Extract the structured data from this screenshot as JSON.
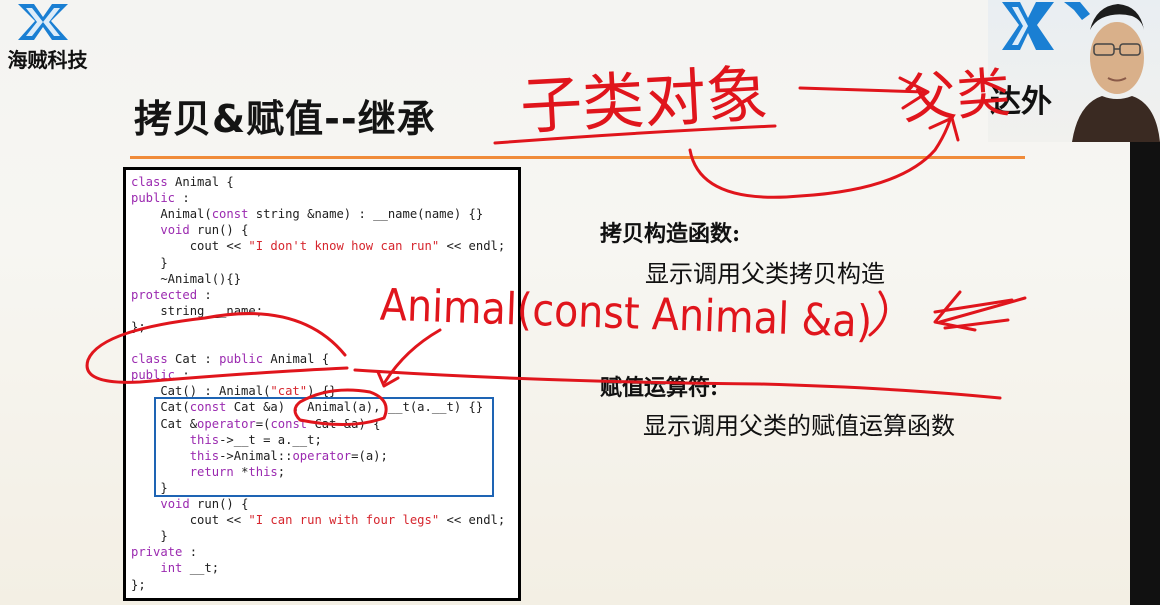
{
  "logo": {
    "name": "海贼科技"
  },
  "slide": {
    "title": "拷贝&赋值--继承"
  },
  "code_lines": [
    {
      "tokens": [
        {
          "t": "class",
          "c": "kw"
        },
        {
          "t": " Animal {",
          "c": ""
        }
      ]
    },
    {
      "tokens": [
        {
          "t": "public",
          "c": "kw"
        },
        {
          "t": " :",
          "c": ""
        }
      ]
    },
    {
      "tokens": [
        {
          "t": "    Animal(",
          "c": ""
        },
        {
          "t": "const",
          "c": "kw"
        },
        {
          "t": " string &name) : __name(name) {}",
          "c": ""
        }
      ]
    },
    {
      "tokens": [
        {
          "t": "    ",
          "c": ""
        },
        {
          "t": "void",
          "c": "kw"
        },
        {
          "t": " run() {",
          "c": ""
        }
      ]
    },
    {
      "tokens": [
        {
          "t": "        cout << ",
          "c": ""
        },
        {
          "t": "\"I don't know how can run\"",
          "c": "str"
        },
        {
          "t": " << endl;",
          "c": ""
        }
      ]
    },
    {
      "tokens": [
        {
          "t": "    }",
          "c": ""
        }
      ]
    },
    {
      "tokens": [
        {
          "t": "    ~Animal(){}",
          "c": ""
        }
      ]
    },
    {
      "tokens": [
        {
          "t": "protected",
          "c": "kw"
        },
        {
          "t": " :",
          "c": ""
        }
      ]
    },
    {
      "tokens": [
        {
          "t": "    string __name;",
          "c": ""
        }
      ]
    },
    {
      "tokens": [
        {
          "t": "};",
          "c": ""
        }
      ]
    },
    {
      "tokens": [
        {
          "t": "",
          "c": ""
        }
      ]
    },
    {
      "tokens": [
        {
          "t": "class",
          "c": "kw"
        },
        {
          "t": " Cat : ",
          "c": ""
        },
        {
          "t": "public",
          "c": "kw"
        },
        {
          "t": " Animal {",
          "c": ""
        }
      ]
    },
    {
      "tokens": [
        {
          "t": "public",
          "c": "kw"
        },
        {
          "t": " :",
          "c": ""
        }
      ]
    },
    {
      "tokens": [
        {
          "t": "    Cat() : Animal(",
          "c": ""
        },
        {
          "t": "\"cat\"",
          "c": "str"
        },
        {
          "t": ") {}",
          "c": ""
        }
      ]
    },
    {
      "tokens": [
        {
          "t": "    Cat(",
          "c": ""
        },
        {
          "t": "const",
          "c": "kw"
        },
        {
          "t": " Cat &a) : Animal(a), __t(a.__t) {}",
          "c": ""
        }
      ]
    },
    {
      "tokens": [
        {
          "t": "    Cat &",
          "c": ""
        },
        {
          "t": "operator",
          "c": "kw"
        },
        {
          "t": "=(",
          "c": ""
        },
        {
          "t": "const",
          "c": "kw"
        },
        {
          "t": " Cat &a) {",
          "c": ""
        }
      ]
    },
    {
      "tokens": [
        {
          "t": "        ",
          "c": ""
        },
        {
          "t": "this",
          "c": "kw"
        },
        {
          "t": "->__t = a.__t;",
          "c": ""
        }
      ]
    },
    {
      "tokens": [
        {
          "t": "        ",
          "c": ""
        },
        {
          "t": "this",
          "c": "kw"
        },
        {
          "t": "->Animal::",
          "c": ""
        },
        {
          "t": "operator",
          "c": "kw"
        },
        {
          "t": "=(a);",
          "c": ""
        }
      ]
    },
    {
      "tokens": [
        {
          "t": "        ",
          "c": ""
        },
        {
          "t": "return",
          "c": "kw"
        },
        {
          "t": " *",
          "c": ""
        },
        {
          "t": "this",
          "c": "kw"
        },
        {
          "t": ";",
          "c": ""
        }
      ]
    },
    {
      "tokens": [
        {
          "t": "    }",
          "c": ""
        }
      ]
    },
    {
      "tokens": [
        {
          "t": "    ",
          "c": ""
        },
        {
          "t": "void",
          "c": "kw"
        },
        {
          "t": " run() {",
          "c": ""
        }
      ]
    },
    {
      "tokens": [
        {
          "t": "        cout << ",
          "c": ""
        },
        {
          "t": "\"I can run with four legs\"",
          "c": "str"
        },
        {
          "t": " << endl;",
          "c": ""
        }
      ]
    },
    {
      "tokens": [
        {
          "t": "    }",
          "c": ""
        }
      ]
    },
    {
      "tokens": [
        {
          "t": "private",
          "c": "kw"
        },
        {
          "t": " :",
          "c": ""
        }
      ]
    },
    {
      "tokens": [
        {
          "t": "    ",
          "c": ""
        },
        {
          "t": "int",
          "c": "kw"
        },
        {
          "t": " __t;",
          "c": ""
        }
      ]
    },
    {
      "tokens": [
        {
          "t": "};",
          "c": ""
        }
      ]
    }
  ],
  "notes": {
    "copy_heading": "拷贝构造函数:",
    "copy_desc": "显示调用父类拷贝构造",
    "assign_heading": "赋值运算符:",
    "assign_desc": "显示调用父类的赋值运算函数"
  },
  "webcam": {
    "visible_text": "达外"
  },
  "annotations": {
    "top_handwriting": "子类对象",
    "arrow_target": "父类",
    "mid_handwriting": "Animal(const Animal &a)"
  },
  "colors": {
    "accent_rule": "#f08b3a",
    "highlight_box": "#1e64b4",
    "ink": "#e0151c",
    "keyword": "#9b2ab0",
    "string": "#d6262e"
  }
}
